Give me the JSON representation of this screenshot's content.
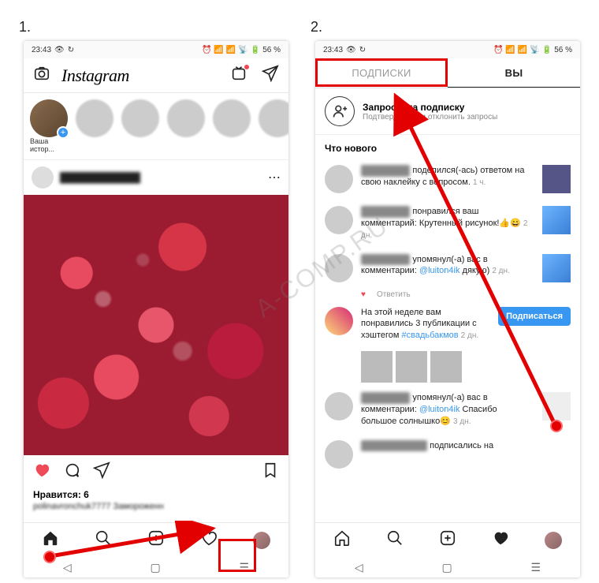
{
  "steps": {
    "one": "1.",
    "two": "2."
  },
  "statusbar": {
    "time": "23:43",
    "battery": "56 %"
  },
  "header": {
    "logo": "Instagram"
  },
  "stories": {
    "your": "Ваша истор..."
  },
  "post": {
    "likes_label": "Нравится: 6",
    "caption_user": "polinavronchuk7777",
    "caption_text": "Замороженн"
  },
  "tabs": {
    "following": "ПОДПИСКИ",
    "you": "Вы"
  },
  "follow_requests": {
    "title": "Запросы на подписку",
    "subtitle": "Подтвердить или отклонить запросы"
  },
  "section": {
    "whats_new": "Что нового"
  },
  "activity": [
    {
      "text1": "поделился(-ась) ответом на свою наклейку с вопросом.",
      "time": "1 ч."
    },
    {
      "text1": "понравился ваш комментарий: Крутенный рисунок!👍😄",
      "time": "2 дн."
    },
    {
      "text1": "упомянул(-а) вас в комментарии:",
      "mention": "@luiton4ik",
      "text2": "дякую)",
      "time": "2 дн."
    },
    {
      "text1": "На этой неделе вам понравились 3 публикации с хэштегом",
      "hashtag": "#свадьбакмов",
      "time": "2 дн."
    },
    {
      "text1": "упомянул(-а) вас в комментарии:",
      "mention": "@luiton4ik",
      "text2": "Спасибо большое солнышко😊",
      "time": "3 дн."
    },
    {
      "text1": "подписались на"
    }
  ],
  "reply": {
    "label": "Ответить"
  },
  "buttons": {
    "subscribe": "Подписаться"
  },
  "watermark": "A-COMP.RU"
}
